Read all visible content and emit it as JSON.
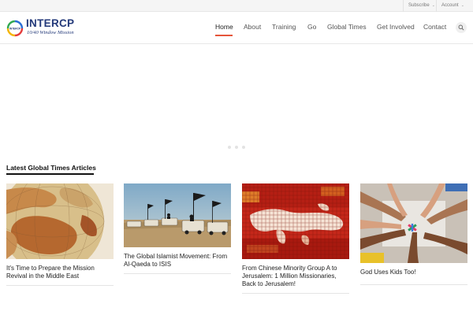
{
  "utility": {
    "subscribe": "Subscribe",
    "account": "Account"
  },
  "brand": {
    "name": "INTERCP",
    "tagline": "10/40 Window Mission",
    "mark_text": "INTERCP"
  },
  "nav": {
    "items": [
      {
        "label": "Home",
        "active": true
      },
      {
        "label": "About",
        "active": false
      },
      {
        "label": "Training",
        "active": false
      },
      {
        "label": "Go",
        "active": false
      },
      {
        "label": "Global Times",
        "active": false
      },
      {
        "label": "Get Involved",
        "active": false
      },
      {
        "label": "Contact",
        "active": false
      }
    ],
    "search_icon": "search-icon",
    "accent_color": "#e5553a"
  },
  "slider": {
    "slide_count": 3,
    "active_slide": 1
  },
  "section": {
    "title": "Latest Global Times Articles"
  },
  "articles": [
    {
      "title": "It's Time to Prepare the Mission Revival in the Middle East",
      "image": "globe-photo"
    },
    {
      "title": "The Global Islamist Movement: From Al-Qaeda to ISIS",
      "image": "convoy-photo"
    },
    {
      "title": "From Chinese Minority Group A to Jerusalem: 1 Million Missionaries, Back to Jerusalem!",
      "image": "mosaic-map-photo"
    },
    {
      "title": "God Uses Kids Too!",
      "image": "children-hands-photo"
    }
  ]
}
